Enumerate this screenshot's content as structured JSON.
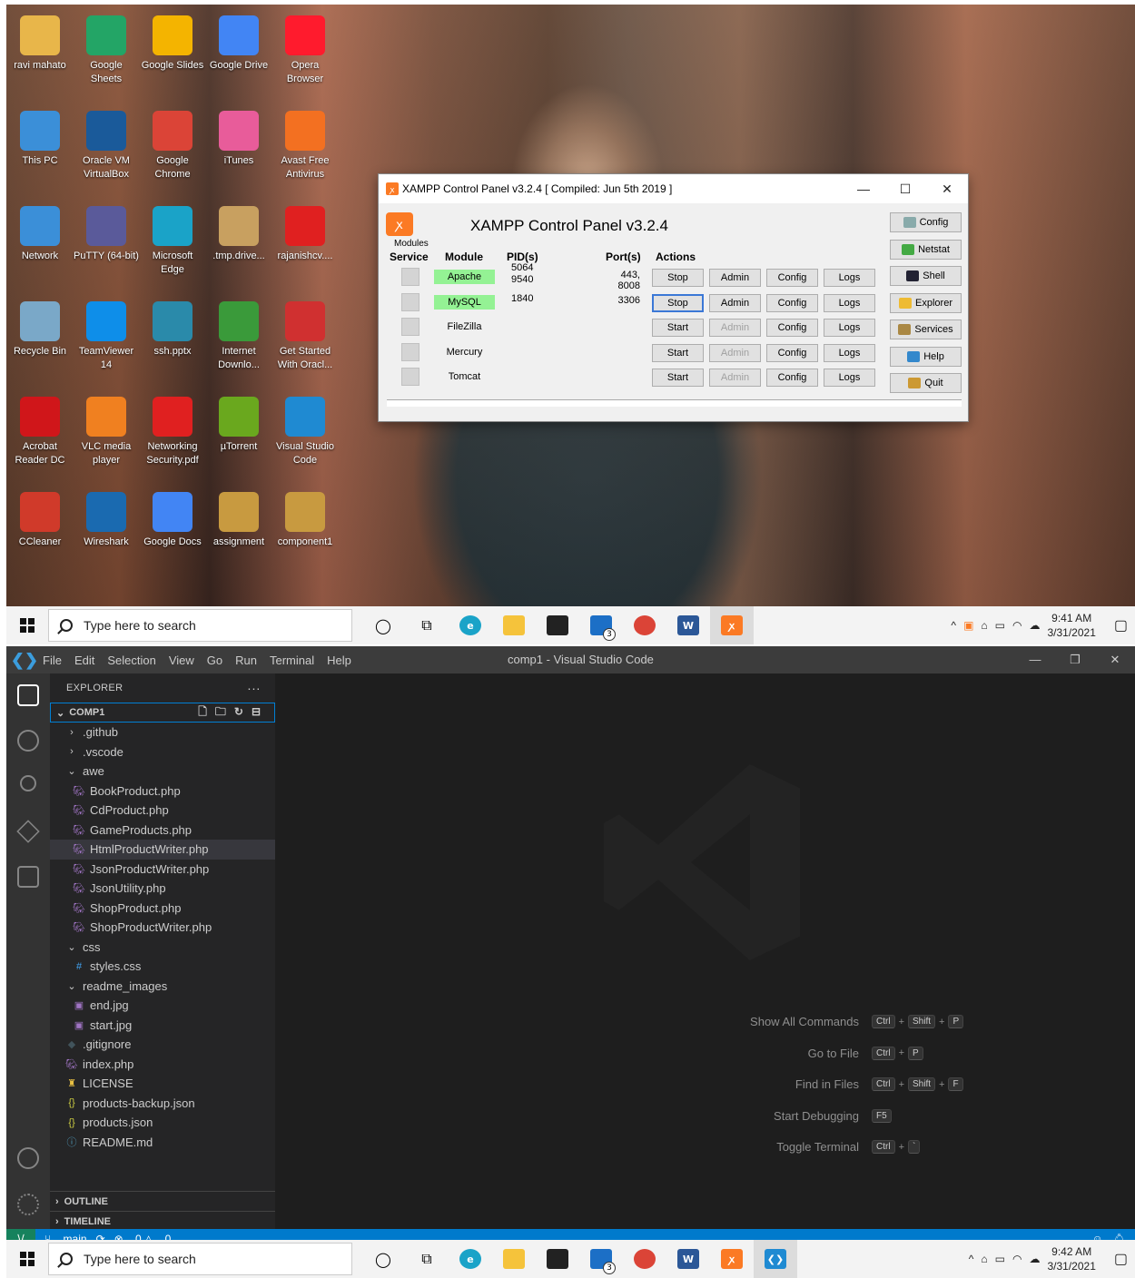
{
  "desktop": {
    "icons": [
      {
        "label": "ravi mahato",
        "icon": "user-folder-icon",
        "color": "#e8b64a"
      },
      {
        "label": "Google Sheets",
        "icon": "sheets-icon",
        "color": "#23a566"
      },
      {
        "label": "Google Slides",
        "icon": "slides-icon",
        "color": "#f4b400"
      },
      {
        "label": "Google Drive",
        "icon": "drive-icon",
        "color": "#4285f4"
      },
      {
        "label": "Opera Browser",
        "icon": "opera-icon",
        "color": "#ff1b2d"
      },
      {
        "label": "This PC",
        "icon": "pc-icon",
        "color": "#3b8fd8"
      },
      {
        "label": "Oracle VM VirtualBox",
        "icon": "virtualbox-icon",
        "color": "#1a5a9a"
      },
      {
        "label": "Google Chrome",
        "icon": "chrome-icon",
        "color": "#db4437"
      },
      {
        "label": "iTunes",
        "icon": "itunes-icon",
        "color": "#e85c9a"
      },
      {
        "label": "Avast Free Antivirus",
        "icon": "avast-icon",
        "color": "#f37021"
      },
      {
        "label": "Network",
        "icon": "network-icon",
        "color": "#3b8fd8"
      },
      {
        "label": "PuTTY (64-bit)",
        "icon": "putty-icon",
        "color": "#5a5a9a"
      },
      {
        "label": "Microsoft Edge",
        "icon": "edge-icon",
        "color": "#1aa3c8"
      },
      {
        "label": ".tmp.drive...",
        "icon": "file-icon",
        "color": "#c8a060"
      },
      {
        "label": "rajanishcv....",
        "icon": "pdf-icon",
        "color": "#e02020"
      },
      {
        "label": "Recycle Bin",
        "icon": "recycle-bin-icon",
        "color": "#7aa8c8"
      },
      {
        "label": "TeamViewer 14",
        "icon": "teamviewer-icon",
        "color": "#0e8ee9"
      },
      {
        "label": "ssh.pptx",
        "icon": "pptx-icon",
        "color": "#2a8aaa"
      },
      {
        "label": "Internet Downlo...",
        "icon": "idm-icon",
        "color": "#3a9a3a"
      },
      {
        "label": "Get Started With Oracl...",
        "icon": "oracle-icon",
        "color": "#d03030"
      },
      {
        "label": "Acrobat Reader DC",
        "icon": "acrobat-icon",
        "color": "#d0161a"
      },
      {
        "label": "VLC media player",
        "icon": "vlc-icon",
        "color": "#f08020"
      },
      {
        "label": "Networking Security.pdf",
        "icon": "pdf-icon",
        "color": "#e02020"
      },
      {
        "label": "µTorrent",
        "icon": "utorrent-icon",
        "color": "#6aa81e"
      },
      {
        "label": "Visual Studio Code",
        "icon": "vscode-icon",
        "color": "#1f8ad2"
      },
      {
        "label": "CCleaner",
        "icon": "ccleaner-icon",
        "color": "#d03a2a"
      },
      {
        "label": "Wireshark",
        "icon": "wireshark-icon",
        "color": "#1a6ab0"
      },
      {
        "label": "Google Docs",
        "icon": "docs-icon",
        "color": "#4285f4"
      },
      {
        "label": "assignment",
        "icon": "document-icon",
        "color": "#c89a40"
      },
      {
        "label": "component1",
        "icon": "document-icon",
        "color": "#c89a40"
      }
    ]
  },
  "taskbar": {
    "search_placeholder": "Type here to search",
    "badge": "3",
    "top_time": "9:41 AM",
    "top_date": "3/31/2021",
    "bottom_time": "9:42 AM",
    "bottom_date": "3/31/2021"
  },
  "xampp": {
    "window_title": "XAMPP Control Panel v3.2.4   [ Compiled: Jun 5th 2019 ]",
    "header": "XAMPP Control Panel v3.2.4",
    "modules_label": "Modules",
    "col_service": "Service",
    "col_module": "Module",
    "col_pid": "PID(s)",
    "col_port": "Port(s)",
    "col_actions": "Actions",
    "btn_admin": "Admin",
    "btn_config": "Config",
    "btn_logs": "Logs",
    "rows": [
      {
        "module": "Apache",
        "pid": "5064\n9540",
        "port": "443, 8008",
        "action": "Stop",
        "running": true
      },
      {
        "module": "MySQL",
        "pid": "1840",
        "port": "3306",
        "action": "Stop",
        "running": true
      },
      {
        "module": "FileZilla",
        "pid": "",
        "port": "",
        "action": "Start",
        "running": false
      },
      {
        "module": "Mercury",
        "pid": "",
        "port": "",
        "action": "Start",
        "running": false
      },
      {
        "module": "Tomcat",
        "pid": "",
        "port": "",
        "action": "Start",
        "running": false
      }
    ],
    "side": [
      "Config",
      "Netstat",
      "Shell",
      "Explorer",
      "Services",
      "Help",
      "Quit"
    ]
  },
  "vscode": {
    "menu": [
      "File",
      "Edit",
      "Selection",
      "View",
      "Go",
      "Run",
      "Terminal",
      "Help"
    ],
    "window_title": "comp1 - Visual Studio Code",
    "explorer_label": "EXPLORER",
    "explorer_more": "···",
    "folder": "COMP1",
    "tree": [
      {
        "name": ".github",
        "depth": 1,
        "kind": "folder-closed",
        "sel": false
      },
      {
        "name": ".vscode",
        "depth": 1,
        "kind": "folder-closed",
        "sel": false
      },
      {
        "name": "awe",
        "depth": 1,
        "kind": "folder-open",
        "sel": false
      },
      {
        "name": "BookProduct.php",
        "depth": 2,
        "kind": "php",
        "sel": false
      },
      {
        "name": "CdProduct.php",
        "depth": 2,
        "kind": "php",
        "sel": false
      },
      {
        "name": "GameProducts.php",
        "depth": 2,
        "kind": "php",
        "sel": false
      },
      {
        "name": "HtmlProductWriter.php",
        "depth": 2,
        "kind": "php",
        "sel": true
      },
      {
        "name": "JsonProductWriter.php",
        "depth": 2,
        "kind": "php",
        "sel": false
      },
      {
        "name": "JsonUtility.php",
        "depth": 2,
        "kind": "php",
        "sel": false
      },
      {
        "name": "ShopProduct.php",
        "depth": 2,
        "kind": "php",
        "sel": false
      },
      {
        "name": "ShopProductWriter.php",
        "depth": 2,
        "kind": "php",
        "sel": false
      },
      {
        "name": "css",
        "depth": 1,
        "kind": "folder-open",
        "sel": false
      },
      {
        "name": "styles.css",
        "depth": 2,
        "kind": "css",
        "sel": false
      },
      {
        "name": "readme_images",
        "depth": 1,
        "kind": "folder-open",
        "sel": false
      },
      {
        "name": "end.jpg",
        "depth": 2,
        "kind": "image",
        "sel": false
      },
      {
        "name": "start.jpg",
        "depth": 2,
        "kind": "image",
        "sel": false
      },
      {
        "name": ".gitignore",
        "depth": 1,
        "kind": "git",
        "sel": false
      },
      {
        "name": "index.php",
        "depth": 1,
        "kind": "php",
        "sel": false
      },
      {
        "name": "LICENSE",
        "depth": 1,
        "kind": "license",
        "sel": false
      },
      {
        "name": "products-backup.json",
        "depth": 1,
        "kind": "json",
        "sel": false
      },
      {
        "name": "products.json",
        "depth": 1,
        "kind": "json",
        "sel": false
      },
      {
        "name": "README.md",
        "depth": 1,
        "kind": "info",
        "sel": false
      }
    ],
    "outline": "OUTLINE",
    "timeline": "TIMELINE",
    "shortcuts": [
      {
        "label": "Show All Commands",
        "keys": [
          "Ctrl",
          "Shift",
          "P"
        ]
      },
      {
        "label": "Go to File",
        "keys": [
          "Ctrl",
          "P"
        ]
      },
      {
        "label": "Find in Files",
        "keys": [
          "Ctrl",
          "Shift",
          "F"
        ]
      },
      {
        "label": "Start Debugging",
        "keys": [
          "F5"
        ]
      },
      {
        "label": "Toggle Terminal",
        "keys": [
          "Ctrl",
          "`"
        ]
      }
    ],
    "status": {
      "branch": "main",
      "errors": "0",
      "warnings": "0"
    }
  }
}
